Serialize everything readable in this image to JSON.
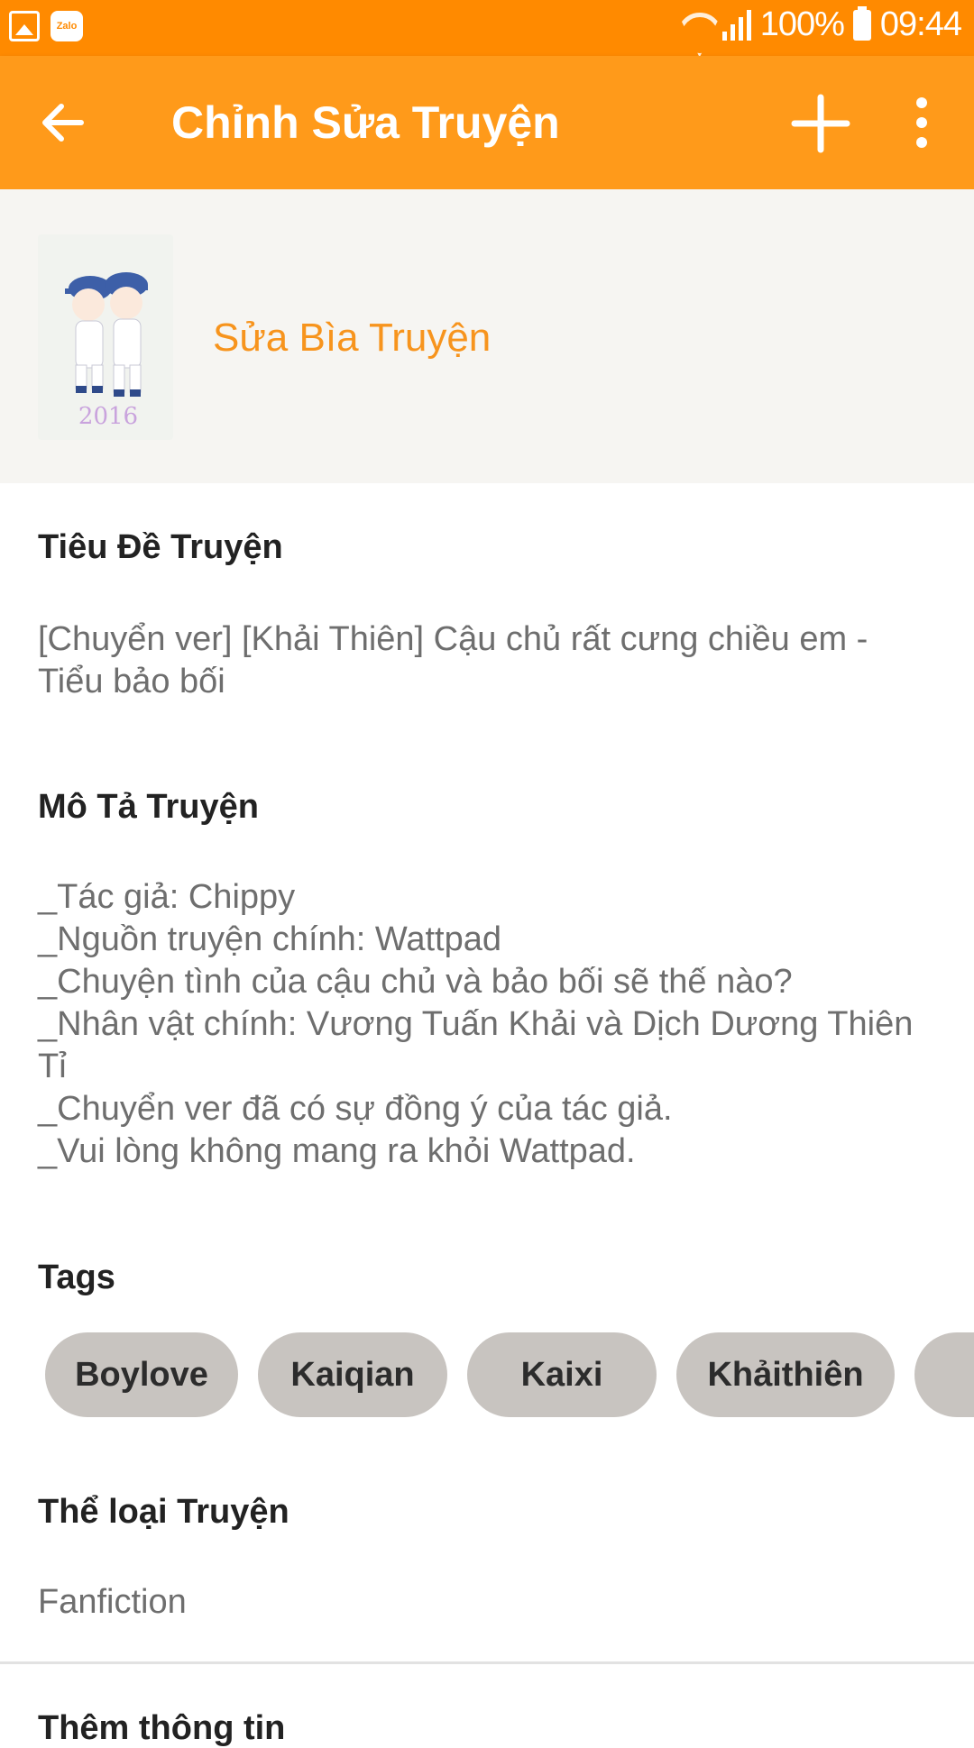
{
  "status_bar": {
    "battery": "100%",
    "time": "09:44",
    "zalo_label": "Zalo"
  },
  "app_bar": {
    "title": "Chỉnh Sửa Truyện"
  },
  "cover": {
    "edit_label": "Sửa Bìa Truyện",
    "year_text": "2016"
  },
  "title_section": {
    "heading": "Tiêu Đề Truyện",
    "value_line1": "[Chuyển ver] [Khải Thiên] Cậu chủ rất cưng chiều em -",
    "value_line2": "Tiểu bảo bối"
  },
  "description_section": {
    "heading": "Mô Tả Truyện",
    "lines": [
      "_Tác giả: Chippy",
      "_Nguồn truyện chính: Wattpad",
      "_Chuyện tình của cậu chủ và bảo bối sẽ thế nào?",
      "_Nhân vật chính: Vương Tuấn Khải và Dịch Dương Thiên",
      "Tỉ",
      "_Chuyển ver đã có sự đồng ý của tác giả.",
      "_Vui lòng không mang ra khỏi Wattpad."
    ]
  },
  "tags_section": {
    "heading": "Tags",
    "tags": [
      "Boylove",
      "Kaiqian",
      "Kaixi",
      "Khảithiên",
      ""
    ]
  },
  "genre_section": {
    "heading": "Thể loại Truyện",
    "value": "Fanfiction"
  },
  "more_info": {
    "heading": "Thêm thông tin"
  },
  "colors": {
    "status_bar": "#ff8a00",
    "app_bar": "#ff9a1a",
    "accent": "#f7941d",
    "tag_bg": "#c8c4c0"
  }
}
